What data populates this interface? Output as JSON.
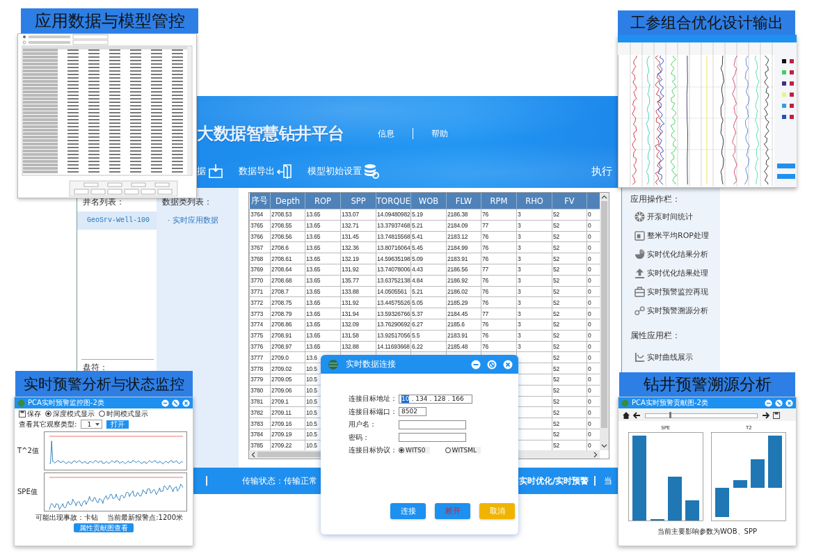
{
  "top_left_panel": {
    "title": "应用数据与模型管控"
  },
  "top_right_panel": {
    "title": "工参组合优化设计输出"
  },
  "main_app": {
    "app_title": "大数据智慧钻井平台",
    "header_links": [
      "信息",
      "帮助"
    ],
    "menu": [
      {
        "label": "据"
      },
      {
        "label": "数据导出"
      },
      {
        "label": "模型初始设置"
      }
    ],
    "menu_right": "执行",
    "well_list": {
      "heading": "井名列表：",
      "items": [
        {
          "label": "GeoSrv-Well-100",
          "selected": true
        }
      ]
    },
    "data_list": {
      "heading": "数据类列表：",
      "items": [
        "· 实时应用数据"
      ]
    },
    "drive_label": "盘符：",
    "table": {
      "columns": [
        "序号",
        "Depth",
        "ROP",
        "SPP",
        "TORQUE",
        "WOB",
        "FLW",
        "RPM",
        "RHO",
        "FV"
      ],
      "rows": [
        [
          "3764",
          "2708.53",
          "13.65",
          "133.07",
          "14.09480982",
          "5.19",
          "2186.38",
          "76",
          "3",
          "52",
          "0"
        ],
        [
          "3765",
          "2708.55",
          "13.65",
          "132.71",
          "13.37937468",
          "5.21",
          "2184.09",
          "77",
          "3",
          "52",
          "0"
        ],
        [
          "3766",
          "2708.56",
          "13.65",
          "131.45",
          "13.74815568",
          "5.41",
          "2183.12",
          "76",
          "3",
          "52",
          "0"
        ],
        [
          "3767",
          "2708.6",
          "13.65",
          "132.36",
          "13.80716064",
          "5.45",
          "2184.99",
          "76",
          "3",
          "52",
          "0"
        ],
        [
          "3768",
          "2708.61",
          "13.65",
          "132.19",
          "14.59635198",
          "5.09",
          "2183.91",
          "76",
          "3",
          "52",
          "0"
        ],
        [
          "3769",
          "2708.64",
          "13.65",
          "131.92",
          "13.74078006",
          "4.43",
          "2186.56",
          "77",
          "3",
          "52",
          "0"
        ],
        [
          "3770",
          "2708.68",
          "13.65",
          "135.77",
          "13.63752138",
          "4.84",
          "2186.92",
          "76",
          "3",
          "52",
          "0"
        ],
        [
          "3771",
          "2708.7",
          "13.65",
          "133.88",
          "14.0505561",
          "5.21",
          "2186.02",
          "76",
          "3",
          "52",
          "0"
        ],
        [
          "3772",
          "2708.75",
          "13.65",
          "131.92",
          "13.44575526",
          "5.05",
          "2185.29",
          "76",
          "3",
          "52",
          "0"
        ],
        [
          "3773",
          "2708.79",
          "13.65",
          "131.94",
          "13.59326766",
          "5.37",
          "2184.45",
          "77",
          "3",
          "52",
          "0"
        ],
        [
          "3774",
          "2708.86",
          "13.65",
          "132.09",
          "13.76290692",
          "6.27",
          "2185.6",
          "76",
          "3",
          "52",
          "0"
        ],
        [
          "3775",
          "2708.91",
          "13.65",
          "131.58",
          "13.92517056",
          "5.5",
          "2183.91",
          "76",
          "3",
          "52",
          "0"
        ],
        [
          "3776",
          "2708.97",
          "13.65",
          "132.88",
          "14.11693668",
          "6.22",
          "2185.48",
          "76",
          "3",
          "52",
          "0"
        ],
        [
          "3777",
          "2709.0",
          "13.6",
          null,
          null,
          null,
          null,
          null,
          null,
          "52",
          "0"
        ],
        [
          "3778",
          "2709.02",
          "10.5",
          null,
          null,
          null,
          null,
          null,
          null,
          "52",
          "0"
        ],
        [
          "3779",
          "2709.05",
          "10.5",
          null,
          null,
          null,
          null,
          null,
          null,
          "52",
          "0"
        ],
        [
          "3780",
          "2709.06",
          "10.5",
          null,
          null,
          null,
          null,
          null,
          null,
          "52",
          "0"
        ],
        [
          "3781",
          "2709.1",
          "10.5",
          null,
          null,
          null,
          null,
          null,
          null,
          "52",
          "0"
        ],
        [
          "3782",
          "2709.11",
          "10.5",
          null,
          null,
          null,
          null,
          null,
          null,
          "52",
          "0"
        ],
        [
          "3783",
          "2709.16",
          "10.5",
          null,
          null,
          null,
          null,
          null,
          null,
          "52",
          "0"
        ],
        [
          "3784",
          "2709.19",
          "10.5",
          null,
          null,
          null,
          null,
          null,
          null,
          "52",
          "0"
        ],
        [
          "3785",
          "2709.22",
          "10.5",
          null,
          null,
          null,
          null,
          null,
          null,
          "52",
          "0"
        ]
      ]
    },
    "operations": {
      "heading": "应用操作栏：",
      "items": [
        "开泵时间统计",
        "整米平均ROP处理",
        "实时优化结果分析",
        "实时优化结果处理",
        "实时预警监控再现",
        "实时预警溯源分析"
      ]
    },
    "properties": {
      "heading": "属性应用栏：",
      "items": [
        "实时曲线展示"
      ]
    },
    "status_bar": [
      "传输状态：传输正常",
      "实时优化/实时预警",
      "当"
    ]
  },
  "connect_dialog": {
    "title": "实时数据连接",
    "fields": [
      {
        "kind": "address",
        "label": "连接目标地址：",
        "parts": [
          {
            "text": "10",
            "selected": true
          },
          {
            "text": ".",
            "selected": false
          },
          {
            "text": "134",
            "selected": false
          },
          {
            "text": ".",
            "selected": false
          },
          {
            "text": "128",
            "selected": false
          },
          {
            "text": ".",
            "selected": false
          },
          {
            "text": "166",
            "selected": false
          }
        ]
      },
      {
        "kind": "short",
        "label": "连接目标端口：",
        "value": "8502"
      },
      {
        "kind": "text",
        "label": "用户名："
      },
      {
        "kind": "text",
        "label": "密码："
      },
      {
        "kind": "radio",
        "label": "连接目标协议：",
        "options": [
          {
            "label": "WITS0",
            "selected": true
          },
          {
            "label": "WITSML",
            "selected": false
          }
        ]
      }
    ],
    "buttons": [
      {
        "label": "连接",
        "kind": "primary"
      },
      {
        "label": "断开",
        "kind": "danger"
      },
      {
        "label": "取消",
        "kind": "warning"
      }
    ]
  },
  "monitor_panel": {
    "title": "实时预警分析与状态监控",
    "window_title": "PCA实时预警监控图-2类",
    "save": "保存",
    "modes": [
      {
        "label": "深度模式显示",
        "selected": true
      },
      {
        "label": "时间模式显示",
        "selected": false
      }
    ],
    "observe_label": "查看其它观察类型:",
    "observe_value": "1",
    "open_button": "打开",
    "charts": [
      {
        "label": "T^2值"
      },
      {
        "label": "SPE值"
      }
    ],
    "accident": "可能出现事故：卡钻",
    "alarm": "当前最新报警点:1200米",
    "button": "属性贡献图查看"
  },
  "trace_panel": {
    "title": "钻井预警溯源分析",
    "window_title": "PCA实时预警贡献图-2类",
    "slider": {
      "level": 0.22
    },
    "charts": [
      {
        "title": "SPE"
      },
      {
        "title": "T2"
      }
    ],
    "footer": "当前主要影响参数为WOB、SPP"
  }
}
